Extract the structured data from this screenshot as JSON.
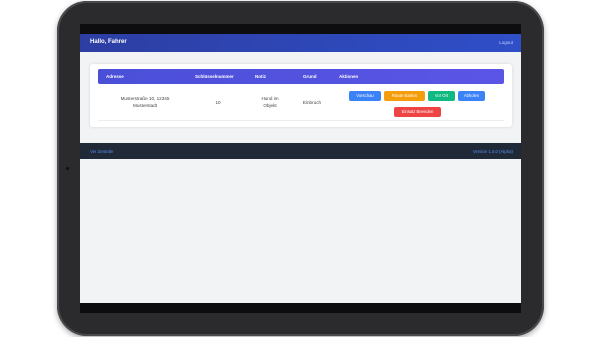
{
  "header": {
    "greeting": "Hallo, Fahrer",
    "logout": "Logout"
  },
  "table": {
    "columns": [
      "Adresse",
      "Schlüsselnummer",
      "Notiz",
      "Grund",
      "Aktionen"
    ],
    "rows": [
      {
        "address_line1": "Musterstraße 10, 12345",
        "address_line2": "Musterstadt",
        "key_number": "10",
        "note_line1": "Hund im",
        "note_line2": "Objekt",
        "reason": "Einbruch",
        "actions": [
          "Vorschau",
          "Route starten",
          "Vor Ort",
          "Abholen",
          "Einsatz Beenden"
        ]
      }
    ]
  },
  "footer": {
    "left": "Ver Zentrale",
    "right": "Version 1.0.0 (Alpha)"
  },
  "colors": {
    "header": "#2f4fc8",
    "table_header": "#5b55e6",
    "btn_preview": "#3b82f6",
    "btn_route": "#f59e0b",
    "btn_onsite": "#10b981",
    "btn_pickup": "#3b82f6",
    "btn_finish": "#ef4444"
  }
}
